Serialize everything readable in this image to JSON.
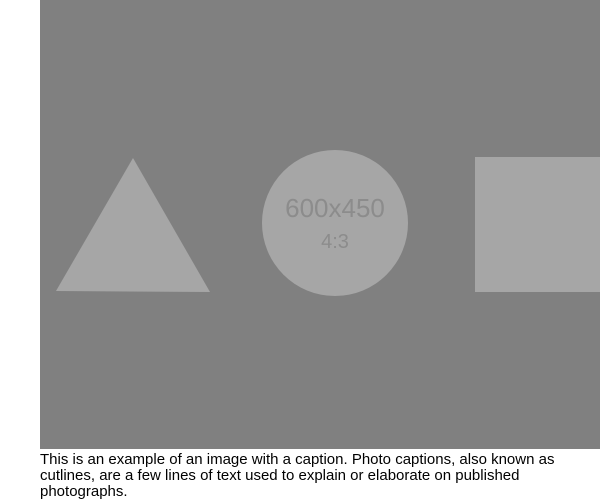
{
  "image_placeholder": {
    "dimensions_text": "600x450",
    "ratio_text": "4:3",
    "background_color": "#808080",
    "shape_color": "#a6a6a6",
    "text_color": "#8c8c8c"
  },
  "caption": {
    "text": "This is an example of an image with a caption. Photo captions, also known as cutlines, are a few lines of text used to explain or elaborate on published photographs."
  }
}
